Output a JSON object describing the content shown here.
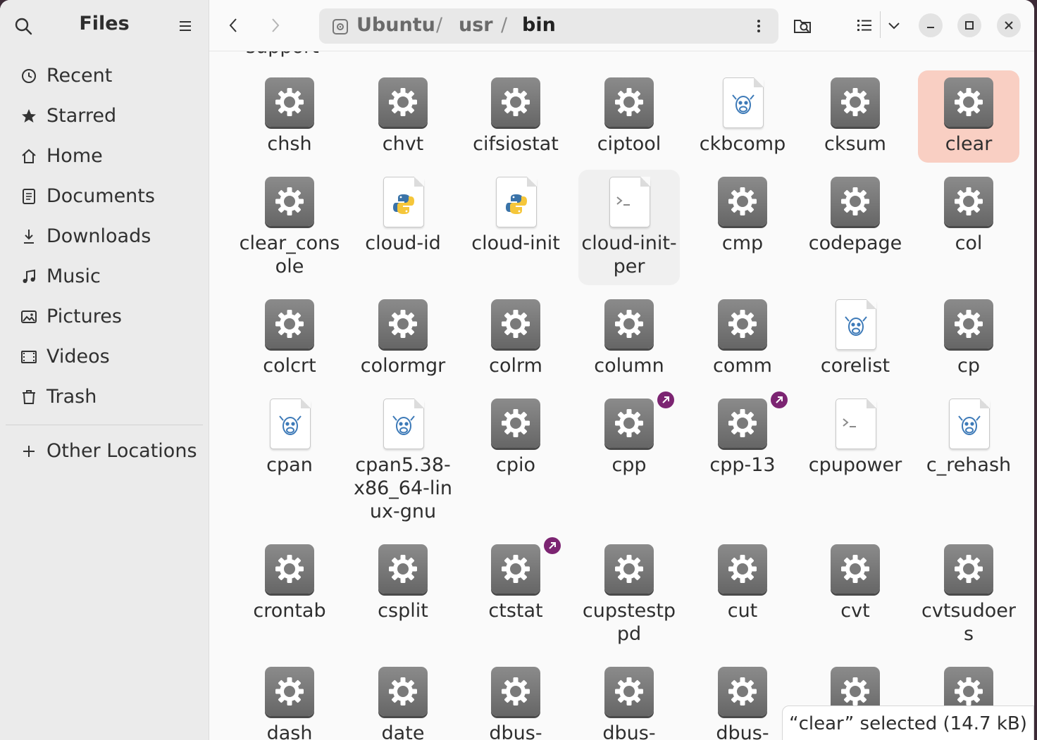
{
  "sidebar": {
    "title": "Files",
    "items": [
      {
        "label": "Recent",
        "icon": "clock-icon"
      },
      {
        "label": "Starred",
        "icon": "star-icon"
      },
      {
        "label": "Home",
        "icon": "home-icon"
      },
      {
        "label": "Documents",
        "icon": "document-icon"
      },
      {
        "label": "Downloads",
        "icon": "download-icon"
      },
      {
        "label": "Music",
        "icon": "music-icon"
      },
      {
        "label": "Pictures",
        "icon": "picture-icon"
      },
      {
        "label": "Videos",
        "icon": "video-icon"
      },
      {
        "label": "Trash",
        "icon": "trash-icon"
      }
    ],
    "other_locations": "Other Locations"
  },
  "header": {
    "path": [
      "Ubuntu",
      "usr",
      "bin"
    ],
    "separator": "/"
  },
  "content": {
    "cutoff_label": "support",
    "rows": [
      [
        {
          "label": "chsh",
          "type": "exec"
        },
        {
          "label": "chvt",
          "type": "exec"
        },
        {
          "label": "cifsiostat",
          "type": "exec"
        },
        {
          "label": "ciptool",
          "type": "exec"
        },
        {
          "label": "ckbcomp",
          "type": "perl"
        },
        {
          "label": "cksum",
          "type": "exec"
        },
        {
          "label": "clear",
          "type": "exec",
          "selected": true
        }
      ],
      [
        {
          "label": "clear_console",
          "type": "exec"
        },
        {
          "label": "cloud-id",
          "type": "python"
        },
        {
          "label": "cloud-init",
          "type": "python"
        },
        {
          "label": "cloud-init-per",
          "type": "script",
          "hover": true
        },
        {
          "label": "cmp",
          "type": "exec"
        },
        {
          "label": "codepage",
          "type": "exec"
        },
        {
          "label": "col",
          "type": "exec"
        }
      ],
      [
        {
          "label": "colcrt",
          "type": "exec"
        },
        {
          "label": "colormgr",
          "type": "exec"
        },
        {
          "label": "colrm",
          "type": "exec"
        },
        {
          "label": "column",
          "type": "exec"
        },
        {
          "label": "comm",
          "type": "exec"
        },
        {
          "label": "corelist",
          "type": "perl"
        },
        {
          "label": "cp",
          "type": "exec"
        }
      ],
      [
        {
          "label": "cpan",
          "type": "perl"
        },
        {
          "label": "cpan5.38-x86_64-linux-gnu",
          "type": "perl"
        },
        {
          "label": "cpio",
          "type": "exec"
        },
        {
          "label": "cpp",
          "type": "exec",
          "link": true
        },
        {
          "label": "cpp-13",
          "type": "exec",
          "link": true
        },
        {
          "label": "cpupower",
          "type": "script"
        },
        {
          "label": "c_rehash",
          "type": "perl"
        }
      ],
      [
        {
          "label": "crontab",
          "type": "exec"
        },
        {
          "label": "csplit",
          "type": "exec"
        },
        {
          "label": "ctstat",
          "type": "exec",
          "link": true
        },
        {
          "label": "cupstestppd",
          "type": "exec"
        },
        {
          "label": "cut",
          "type": "exec"
        },
        {
          "label": "cvt",
          "type": "exec"
        },
        {
          "label": "cvtsudoers",
          "type": "exec"
        }
      ],
      [
        {
          "label": "dash",
          "type": "exec"
        },
        {
          "label": "date",
          "type": "exec"
        },
        {
          "label": "dbus-",
          "type": "exec"
        },
        {
          "label": "dbus-",
          "type": "exec"
        },
        {
          "label": "dbus-",
          "type": "exec"
        },
        {
          "label": "",
          "type": "exec"
        },
        {
          "label": "",
          "type": "exec"
        }
      ]
    ]
  },
  "status": "“clear” selected  (14.7 kB)",
  "colors": {
    "selection": "#f9cfc3",
    "link_badge": "#7c2472",
    "sidebar_bg": "#ebebeb",
    "window_bg": "#fafafa"
  }
}
